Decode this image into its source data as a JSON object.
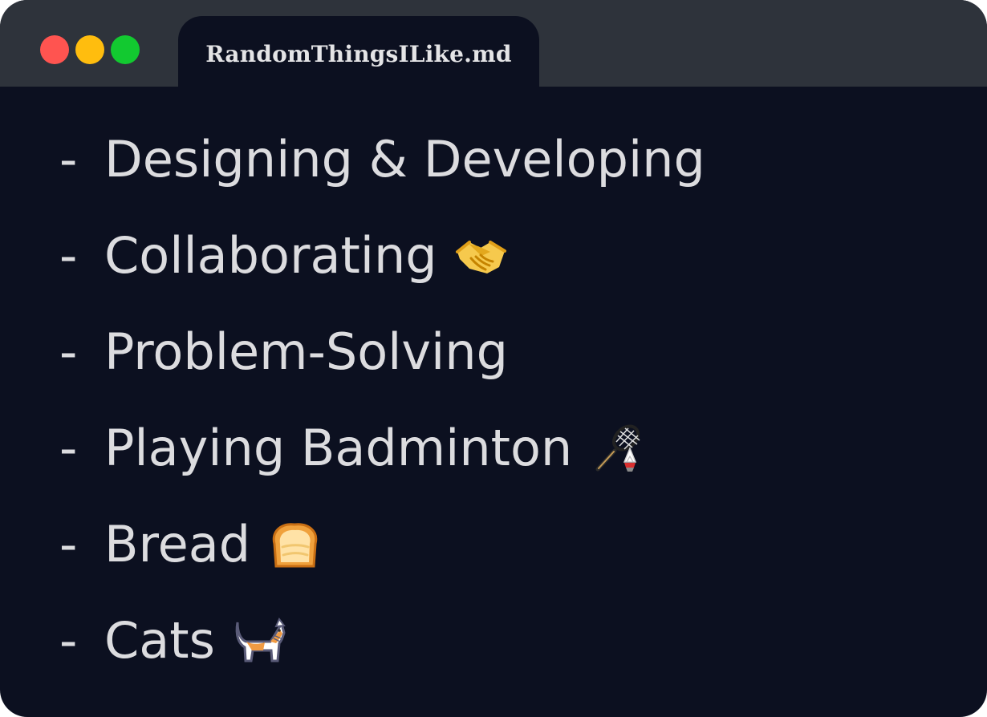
{
  "window": {
    "tab_title": "RandomThingsILike.md"
  },
  "list": {
    "marker": "-",
    "items": [
      {
        "text": "Designing & Developing",
        "icon": ""
      },
      {
        "text": "Collaborating",
        "icon": "handshake-icon"
      },
      {
        "text": "Problem-Solving",
        "icon": ""
      },
      {
        "text": "Playing Badminton",
        "icon": "badminton-icon"
      },
      {
        "text": "Bread",
        "icon": "bread-icon"
      },
      {
        "text": "Cats",
        "icon": "cat-icon"
      }
    ]
  },
  "colors": {
    "editor_background": "#0c1020",
    "titlebar_background": "#2e333b",
    "text": "#dcdcdf",
    "close": "#ff5450",
    "minimize": "#ffbd0e",
    "maximize": "#12c930"
  }
}
